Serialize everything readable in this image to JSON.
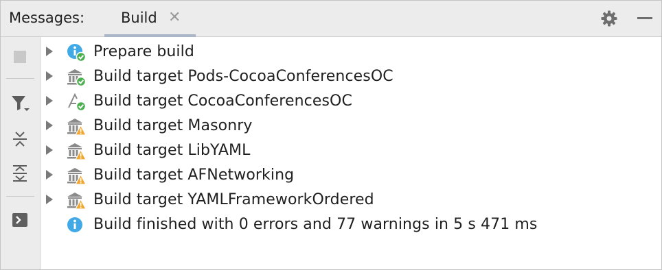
{
  "header": {
    "title": "Messages:",
    "tab_label": "Build",
    "close_glyph": "✕",
    "icons": [
      "gear-icon",
      "minimize-icon"
    ]
  },
  "toolbar": {
    "buttons": [
      "stop-icon",
      "filter-icon",
      "collapse-all-icon",
      "expand-all-icon",
      "terminal-icon"
    ]
  },
  "tree": {
    "rows": [
      {
        "label": "Prepare build",
        "icon": "info-success-icon",
        "expandable": true
      },
      {
        "label": "Build target Pods-CocoaConferencesOC",
        "icon": "library-success-icon",
        "expandable": true
      },
      {
        "label": "Build target CocoaConferencesOC",
        "icon": "app-success-icon",
        "expandable": true
      },
      {
        "label": "Build target Masonry",
        "icon": "library-warning-icon",
        "expandable": true
      },
      {
        "label": "Build target LibYAML",
        "icon": "library-warning-icon",
        "expandable": true
      },
      {
        "label": "Build target AFNetworking",
        "icon": "library-warning-icon",
        "expandable": true
      },
      {
        "label": "Build target YAMLFrameworkOrdered",
        "icon": "library-warning-icon",
        "expandable": true
      },
      {
        "label": "Build finished with 0 errors and 77 warnings in 5 s 471 ms",
        "icon": "info-icon",
        "expandable": false
      }
    ]
  },
  "colors": {
    "info": "#40a9e6",
    "success": "#4caf50",
    "warning": "#f0a732",
    "library": "#8a8a8a",
    "arrow": "#7a7a7a"
  }
}
